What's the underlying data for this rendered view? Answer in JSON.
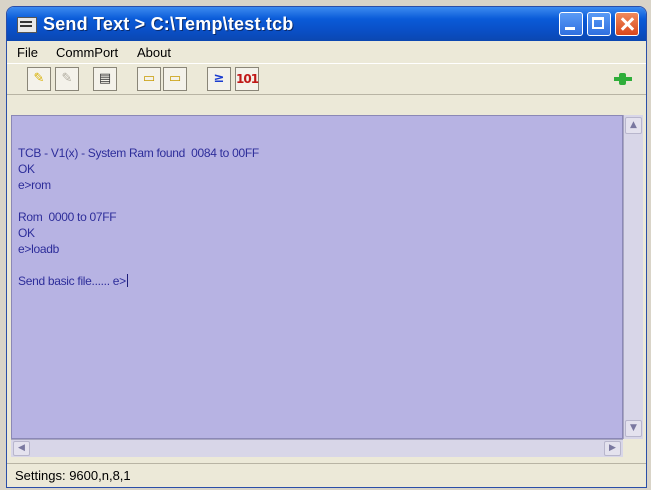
{
  "window": {
    "title": "Send Text > C:\\Temp\\test.tcb"
  },
  "menu": {
    "file": "File",
    "commport": "CommPort",
    "about": "About"
  },
  "toolbar": {
    "icons": [
      "open-folder-icon",
      "disabled-action-icon",
      "properties-icon",
      "folder-open-icon",
      "folder-save-icon",
      "send-text-icon",
      "send-binary-icon",
      "connection-plug-icon"
    ],
    "send_text_glyph": "≥",
    "send_binary_glyph": "101"
  },
  "terminal": {
    "lines": [
      "TCB - V1(x) - System Ram found  0084 to 00FF",
      "OK",
      "e>rom",
      "",
      "Rom  0000 to 07FF",
      "OK",
      "e>loadb",
      "",
      "Send basic file...... e>"
    ],
    "background": "#b7b3e3",
    "text_color": "#2d2d9a"
  },
  "status": {
    "settings": "Settings: 9600,n,8,1"
  }
}
